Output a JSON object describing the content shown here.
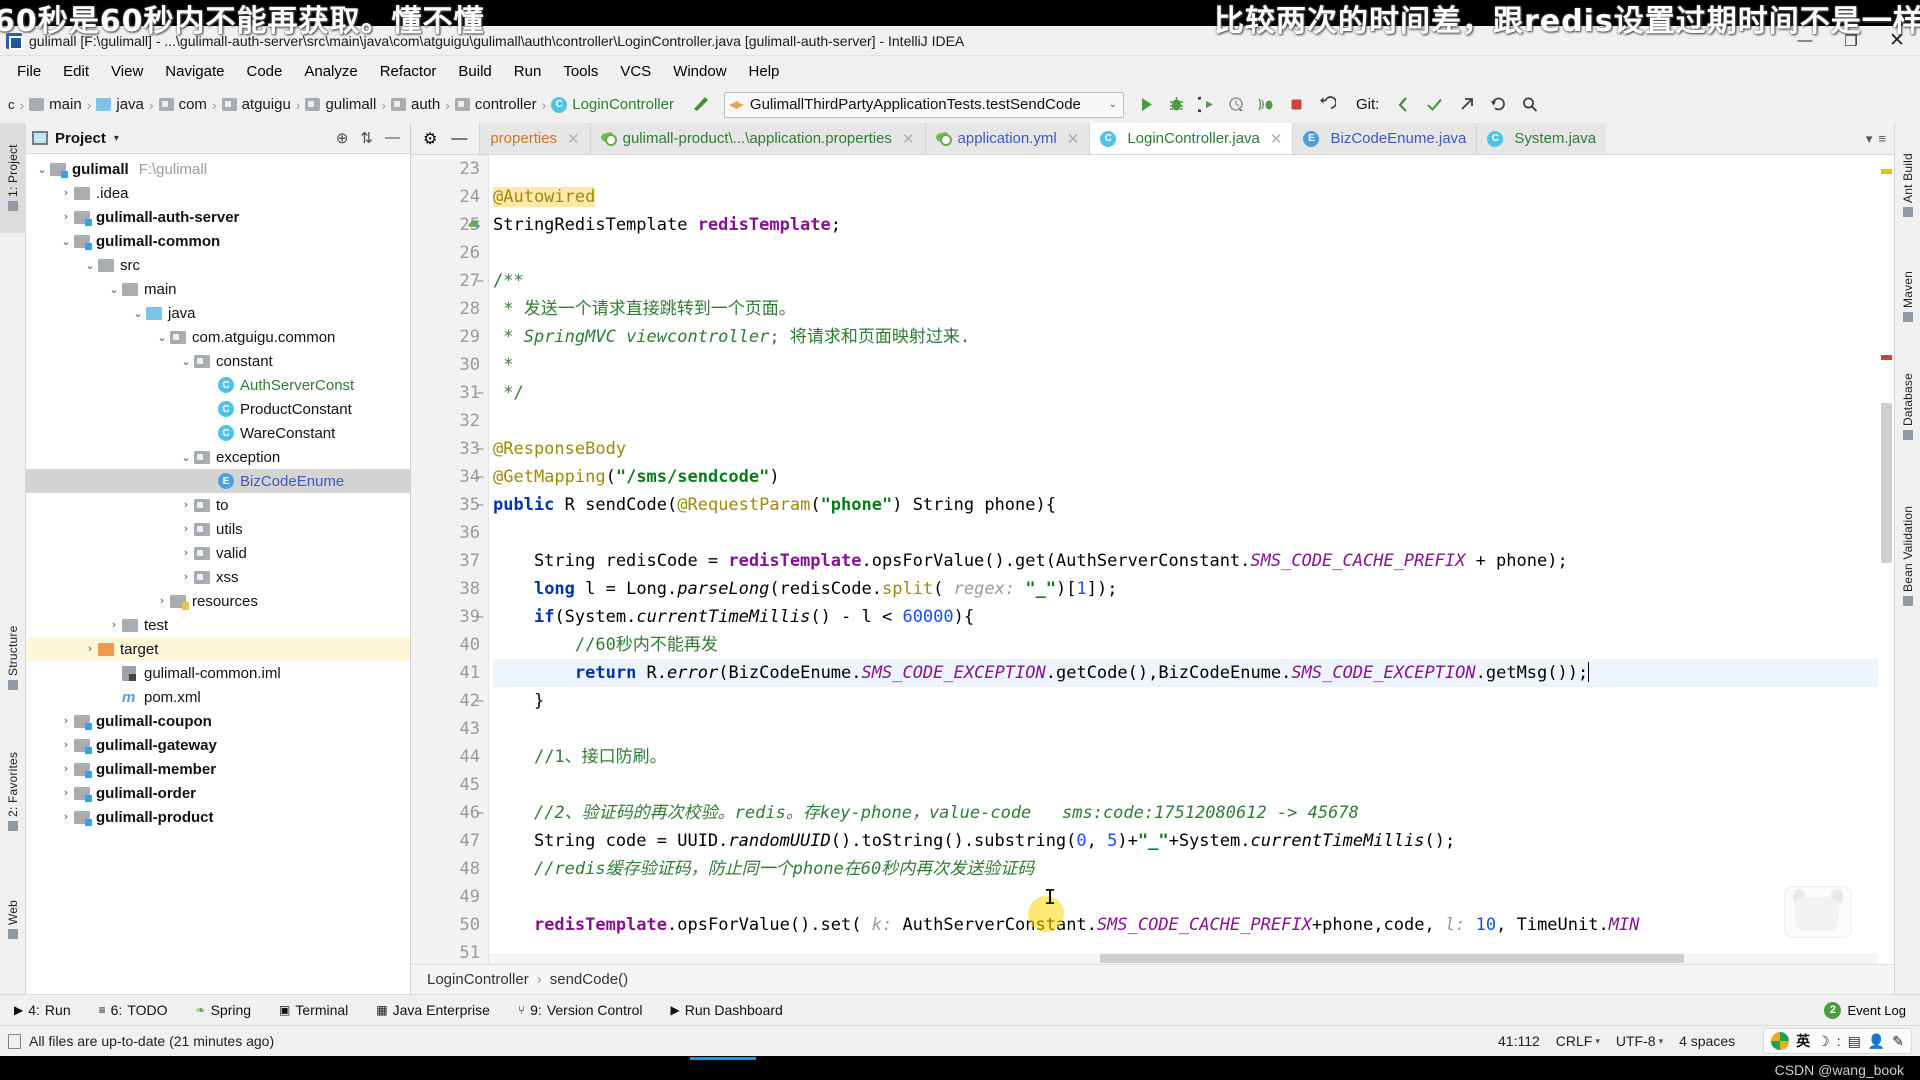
{
  "overlay": {
    "left_text": "60秒是60秒内不能再获取。懂不懂",
    "right_text": "比较两次的时间差，跟redis设置过期时间不是一样"
  },
  "titlebar": {
    "title": "gulimall [F:\\gulimall] - ...\\gulimall-auth-server\\src\\main\\java\\com\\atguigu\\gulimall\\auth\\controller\\LoginController.java [gulimall-auth-server] - IntelliJ IDEA",
    "minimize": "—",
    "maximize": "❐",
    "close": "✕"
  },
  "menubar": {
    "items": [
      "File",
      "Edit",
      "View",
      "Navigate",
      "Code",
      "Analyze",
      "Refactor",
      "Build",
      "Run",
      "Tools",
      "VCS",
      "Window",
      "Help"
    ]
  },
  "breadcrumbs": {
    "leading": "c",
    "items": [
      {
        "label": "main",
        "icon": "folder-icon",
        "color": "grey"
      },
      {
        "label": "java",
        "icon": "folder-icon",
        "color": "blue"
      },
      {
        "label": "com",
        "icon": "package-icon",
        "color": "grey"
      },
      {
        "label": "atguigu",
        "icon": "package-icon",
        "color": "grey"
      },
      {
        "label": "gulimall",
        "icon": "package-icon",
        "color": "grey"
      },
      {
        "label": "auth",
        "icon": "package-icon",
        "color": "grey"
      },
      {
        "label": "controller",
        "icon": "package-icon",
        "color": "grey"
      },
      {
        "label": "LoginController",
        "icon": "class-icon",
        "color": "green"
      }
    ]
  },
  "run_config": {
    "name": "GulimallThirdPartyApplicationTests.testSendCode",
    "caret": "⌄"
  },
  "toolbar": {
    "run_icon": "▶",
    "debug_icon": "🐞",
    "run_coverage_icon": "▷",
    "profile_icon": "⟳",
    "attach_icon": "((",
    "stop_icon": "■",
    "undo_icon": "↺",
    "vcs_label": "Git:",
    "vcs_update_icon": "↙",
    "vcs_commit_icon": "✓",
    "vcs_push_icon": "↗",
    "vcs_history_icon": "⟲",
    "search_icon": "🔍",
    "settings_icon": "⚙"
  },
  "project_panel": {
    "title": "Project",
    "caret": "▾",
    "locate_icon": "⊕",
    "collapse_icon": "⇅",
    "hide_icon": "—",
    "tree": [
      {
        "depth": 0,
        "twist": "⌄",
        "icon": "module-folder-icon",
        "label": "gulimall",
        "bold": true,
        "path": "F:\\gulimall"
      },
      {
        "depth": 1,
        "twist": "›",
        "icon": "folder-icon",
        "label": ".idea",
        "bold": false
      },
      {
        "depth": 1,
        "twist": "›",
        "icon": "module-folder-icon",
        "label": "gulimall-auth-server",
        "bold": true
      },
      {
        "depth": 1,
        "twist": "⌄",
        "icon": "module-folder-icon",
        "label": "gulimall-common",
        "bold": true
      },
      {
        "depth": 2,
        "twist": "⌄",
        "icon": "folder-icon",
        "label": "src",
        "bold": false
      },
      {
        "depth": 3,
        "twist": "⌄",
        "icon": "folder-icon",
        "label": "main",
        "bold": false
      },
      {
        "depth": 4,
        "twist": "⌄",
        "icon": "source-folder-icon",
        "label": "java",
        "bold": false
      },
      {
        "depth": 5,
        "twist": "⌄",
        "icon": "package-icon",
        "label": "com.atguigu.common",
        "bold": false
      },
      {
        "depth": 6,
        "twist": "⌄",
        "icon": "package-icon",
        "label": "constant",
        "bold": false
      },
      {
        "depth": 7,
        "twist": "",
        "icon": "class-icon",
        "label": "AuthServerConst",
        "color": "green"
      },
      {
        "depth": 7,
        "twist": "",
        "icon": "class-icon",
        "label": "ProductConstant",
        "color": "plain"
      },
      {
        "depth": 7,
        "twist": "",
        "icon": "class-icon",
        "label": "WareConstant",
        "color": "plain"
      },
      {
        "depth": 6,
        "twist": "⌄",
        "icon": "package-icon",
        "label": "exception",
        "bold": false
      },
      {
        "depth": 7,
        "twist": "",
        "icon": "enum-icon",
        "label": "BizCodeEnume",
        "color": "blue",
        "selected": "grey"
      },
      {
        "depth": 6,
        "twist": "›",
        "icon": "package-icon",
        "label": "to",
        "bold": false
      },
      {
        "depth": 6,
        "twist": "›",
        "icon": "package-icon",
        "label": "utils",
        "bold": false
      },
      {
        "depth": 6,
        "twist": "›",
        "icon": "package-icon",
        "label": "valid",
        "bold": false
      },
      {
        "depth": 6,
        "twist": "›",
        "icon": "package-icon",
        "label": "xss",
        "bold": false
      },
      {
        "depth": 5,
        "twist": "›",
        "icon": "resource-folder-icon",
        "label": "resources",
        "bold": false
      },
      {
        "depth": 3,
        "twist": "›",
        "icon": "folder-icon",
        "label": "test",
        "bold": false
      },
      {
        "depth": 2,
        "twist": "›",
        "icon": "target-folder-icon",
        "label": "target",
        "bold": false,
        "selected": "yellow"
      },
      {
        "depth": 3,
        "twist": "",
        "icon": "iml-icon",
        "label": "gulimall-common.iml",
        "bold": false
      },
      {
        "depth": 3,
        "twist": "",
        "icon": "maven-icon",
        "label": "pom.xml",
        "bold": false
      },
      {
        "depth": 1,
        "twist": "›",
        "icon": "module-folder-icon",
        "label": "gulimall-coupon",
        "bold": true
      },
      {
        "depth": 1,
        "twist": "›",
        "icon": "module-folder-icon",
        "label": "gulimall-gateway",
        "bold": true
      },
      {
        "depth": 1,
        "twist": "›",
        "icon": "module-folder-icon",
        "label": "gulimall-member",
        "bold": true
      },
      {
        "depth": 1,
        "twist": "›",
        "icon": "module-folder-icon",
        "label": "gulimall-order",
        "bold": true
      },
      {
        "depth": 1,
        "twist": "›",
        "icon": "module-folder-icon",
        "label": "gulimall-product",
        "bold": true
      }
    ]
  },
  "left_strip": {
    "tabs": [
      {
        "label": "1: Project",
        "selected": true
      },
      {
        "label": "Structure",
        "selected": false
      },
      {
        "label": "2: Favorites",
        "selected": false
      },
      {
        "label": "Web",
        "selected": false
      }
    ]
  },
  "right_strip": {
    "tabs": [
      {
        "label": "Ant Build"
      },
      {
        "label": "Maven"
      },
      {
        "label": "Database"
      },
      {
        "label": "Bean Validation"
      }
    ]
  },
  "editor_tabs": {
    "settings_icon": "⚙",
    "hide_icon": "—",
    "items": [
      {
        "label": "properties",
        "icon": "properties-icon",
        "color": "orange",
        "active": false,
        "clipped": true
      },
      {
        "label": "gulimall-product\\...\\application.properties",
        "icon": "yml-icon",
        "color": "green",
        "active": false
      },
      {
        "label": "application.yml",
        "icon": "yml-icon",
        "color": "blue",
        "active": false
      },
      {
        "label": "LoginController.java",
        "icon": "class-icon",
        "color": "green",
        "active": true
      },
      {
        "label": "BizCodeEnume.java",
        "icon": "enum-icon",
        "color": "blue",
        "active": false
      },
      {
        "label": "System.java",
        "icon": "class-icon",
        "color": "green",
        "active": false
      }
    ],
    "overflow": "▾"
  },
  "code": {
    "first_line_number": 23,
    "lines": [
      {
        "n": 23,
        "text": ""
      },
      {
        "n": 24,
        "text": "@Autowired",
        "annotation_highlight": true
      },
      {
        "n": 25,
        "text": "StringRedisTemplate redisTemplate;",
        "gutter_icon": "bean-icon"
      },
      {
        "n": 26,
        "text": ""
      },
      {
        "n": 27,
        "text": "/**",
        "fold": "−"
      },
      {
        "n": 28,
        "text": " * 发送一个请求直接跳转到一个页面。"
      },
      {
        "n": 29,
        "text": " * SpringMVC viewcontroller; 将请求和页面映射过来."
      },
      {
        "n": 30,
        "text": " *"
      },
      {
        "n": 31,
        "text": " */",
        "fold": "−"
      },
      {
        "n": 32,
        "text": ""
      },
      {
        "n": 33,
        "text": "@ResponseBody",
        "fold": "−"
      },
      {
        "n": 34,
        "text": "@GetMapping(\"/sms/sendcode\")",
        "fold": "−"
      },
      {
        "n": 35,
        "text": "public R sendCode(@RequestParam(\"phone\") String phone){",
        "fold": "−"
      },
      {
        "n": 36,
        "text": ""
      },
      {
        "n": 37,
        "text": "    String redisCode = redisTemplate.opsForValue().get(AuthServerConstant.SMS_CODE_CACHE_PREFIX + phone);"
      },
      {
        "n": 38,
        "text": "    long l = Long.parseLong(redisCode.split( regex: \"_\")[1]);"
      },
      {
        "n": 39,
        "text": "    if(System.currentTimeMillis() - l < 60000){",
        "fold": "−"
      },
      {
        "n": 40,
        "text": "        //60秒内不能再发"
      },
      {
        "n": 41,
        "text": "        return R.error(BizCodeEnume.SMS_CODE_EXCEPTION.getCode(),BizCodeEnume.SMS_CODE_EXCEPTION.getMsg());",
        "current": true
      },
      {
        "n": 42,
        "text": "    }",
        "fold": "−"
      },
      {
        "n": 43,
        "text": ""
      },
      {
        "n": 44,
        "text": "    //1、接口防刷。"
      },
      {
        "n": 45,
        "text": ""
      },
      {
        "n": 46,
        "text": "    //2、验证码的再次校验。redis。存key-phone，value-code   sms:code:17512080612 -> 45678",
        "fold": "−"
      },
      {
        "n": 47,
        "text": "    String code = UUID.randomUUID().toString().substring(0, 5)+\"_\"+System.currentTimeMillis();"
      },
      {
        "n": 48,
        "text": "    //redis缓存验证码，防止同一个phone在60秒内再次发送验证码"
      },
      {
        "n": 49,
        "text": ""
      },
      {
        "n": 50,
        "text": "    redisTemplate.opsForValue().set( k: AuthServerConstant.SMS_CODE_CACHE_PREFIX+phone,code, l: 10, TimeUnit.MIN"
      },
      {
        "n": 51,
        "text": ""
      }
    ]
  },
  "editor_breadcrumb": {
    "items": [
      "LoginController",
      "sendCode()"
    ],
    "separator": "›"
  },
  "bottom_tools": {
    "items": [
      {
        "icon": "▶",
        "num": "4:",
        "label": "Run"
      },
      {
        "icon": "≡",
        "num": "6:",
        "label": "TODO"
      },
      {
        "icon": "spring-icon",
        "num": "",
        "label": "Spring"
      },
      {
        "icon": "terminal-icon",
        "num": "",
        "label": "Terminal"
      },
      {
        "icon": "java-ee-icon",
        "num": "",
        "label": "Java Enterprise"
      },
      {
        "icon": "vcs-icon",
        "num": "9:",
        "label": "Version Control"
      },
      {
        "icon": "▶",
        "num": "",
        "label": "Run Dashboard"
      }
    ],
    "event_log": "Event Log",
    "event_log_icon": "2"
  },
  "statusbar": {
    "message": "All files are up-to-date (21 minutes ago)",
    "position": "41:112",
    "line_sep": "CRLF",
    "encoding": "UTF-8",
    "indent": "4 spaces",
    "ime_lang": "英",
    "caret": "⌄"
  },
  "watermark": {
    "credit": "CSDN @wang_book"
  },
  "colors": {
    "accent_blue": "#4fc3e8",
    "green": "#2f7d32",
    "keyword_blue": "#0033b3",
    "string_green": "#067d17",
    "field_purple": "#871094",
    "annotation_yellow": "#9e880d",
    "chrome_grey": "#f0f0f0"
  }
}
